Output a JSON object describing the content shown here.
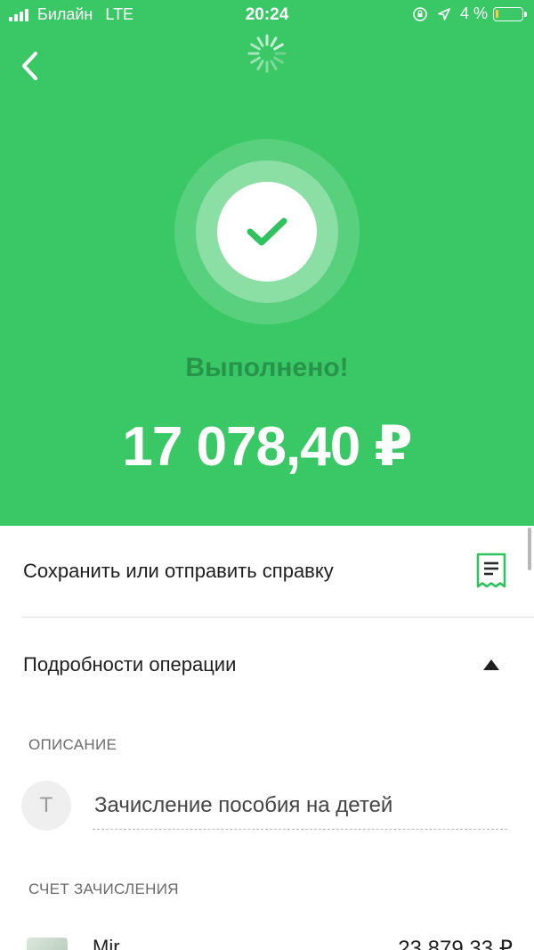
{
  "status_bar": {
    "carrier": "Билайн",
    "network": "LTE",
    "time": "20:24",
    "battery": "4 %",
    "battery_level": 0.04
  },
  "header": {
    "back_icon": "chevron-left-icon",
    "loading_icon": "spinner-icon"
  },
  "result": {
    "icon": "checkmark-icon",
    "title": "Выполнено!",
    "amount": "17 078,40 ₽"
  },
  "actions": {
    "receipt_label": "Сохранить или отправить справку",
    "receipt_icon": "receipt-icon",
    "details_label": "Подробности операции",
    "details_icon": "caret-up-icon"
  },
  "details": {
    "description_header": "ОПИСАНИЕ",
    "description_avatar": "Т",
    "description_text": "Зачисление пособия на детей",
    "account_header": "СЧЕТ ЗАЧИСЛЕНИЯ",
    "account_name": "Mir",
    "account_balance": "23 879,33 ₽"
  },
  "colors": {
    "hero_green": "#3ac765",
    "title_green": "#27944a",
    "check_green": "#2fc25f"
  }
}
